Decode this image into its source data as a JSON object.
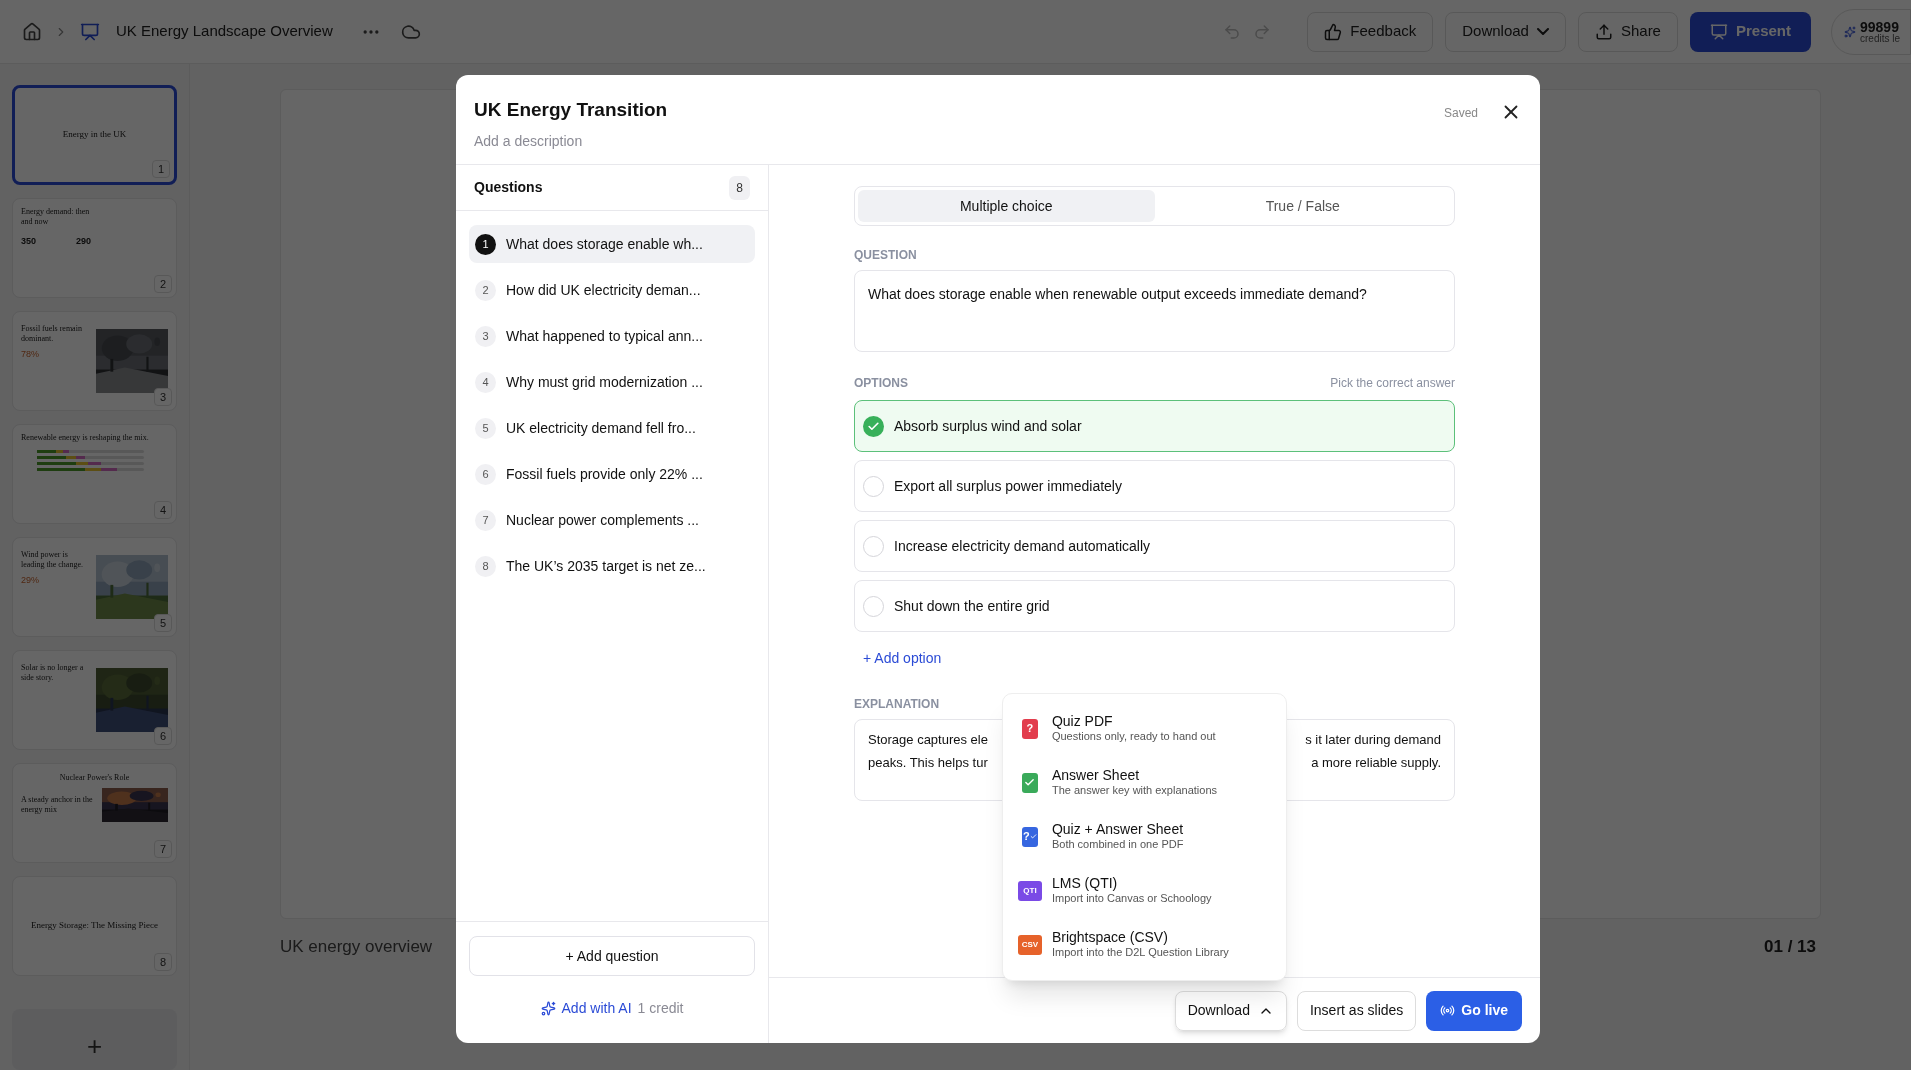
{
  "app": {
    "title": "UK Energy Landscape Overview",
    "feedback": "Feedback",
    "download": "Download",
    "share": "Share",
    "present": "Present",
    "credits": "99899",
    "credits_label": "credits le"
  },
  "slides": [
    {
      "number": "1",
      "kind": "title",
      "title": "Energy in the UK",
      "selected": true
    },
    {
      "number": "2",
      "kind": "stats",
      "title": "Energy demand: then and now",
      "stats": [
        "350",
        "290"
      ],
      "selected": false
    },
    {
      "number": "3",
      "title": "Fossil fuels remain dominant.",
      "figure": "78%",
      "selected": false
    },
    {
      "number": "4",
      "kind": "bars",
      "title": "Renewable energy is reshaping the mix.",
      "selected": false
    },
    {
      "number": "5",
      "title": "Wind power is leading the change.",
      "figure": "29%",
      "selected": false
    },
    {
      "number": "6",
      "title": "Solar is no longer a side story.",
      "selected": false
    },
    {
      "number": "7",
      "kind": "title-photo",
      "title": "Nuclear Power's Role",
      "subtitle": "A steady anchor in the energy mix",
      "selected": false
    },
    {
      "number": "8",
      "kind": "title",
      "title": "Energy Storage: The Missing Piece",
      "selected": false
    }
  ],
  "add_slide": "+",
  "stage": {
    "caption": "UK energy overview",
    "counter": "01 / 13"
  },
  "modal": {
    "title": "UK Energy Transition",
    "description_placeholder": "Add a description",
    "status": "Saved",
    "questions_header": "Questions",
    "question_count": "8",
    "questions": [
      {
        "number": "1",
        "text": "What does storage enable wh...",
        "selected": true
      },
      {
        "number": "2",
        "text": "How did UK electricity deman...",
        "selected": false
      },
      {
        "number": "3",
        "text": "What happened to typical ann...",
        "selected": false
      },
      {
        "number": "4",
        "text": "Why must grid modernization ...",
        "selected": false
      },
      {
        "number": "5",
        "text": "UK electricity demand fell fro...",
        "selected": false
      },
      {
        "number": "6",
        "text": "Fossil fuels provide only 22% ...",
        "selected": false
      },
      {
        "number": "7",
        "text": "Nuclear power complements ...",
        "selected": false
      },
      {
        "number": "8",
        "text": "The UK’s 2035 target is net ze...",
        "selected": false
      }
    ],
    "add_question": "+ Add question",
    "add_ai": "Add with AI",
    "ai_cost": "1 credit",
    "type_tabs": [
      {
        "label": "Multiple choice",
        "selected": true
      },
      {
        "label": "True / False",
        "selected": false
      }
    ],
    "question_label": "QUESTION",
    "question_text": "What does storage enable when renewable output exceeds immediate demand?",
    "options_label": "OPTIONS",
    "options_hint": "Pick the correct answer",
    "options": [
      {
        "text": "Absorb surplus wind and solar",
        "checked": true
      },
      {
        "text": "Export all surplus power immediately",
        "checked": false
      },
      {
        "text": "Increase electricity demand automatically",
        "checked": false
      },
      {
        "text": "Shut down the entire grid",
        "checked": false
      }
    ],
    "add_option": "+ Add option",
    "explanation_label": "EXPLANATION",
    "explanation_lines": [
      {
        "left": "Storage captures ele",
        "right": "s it later during demand"
      },
      {
        "left": "peaks. This helps tur",
        "right": "a more reliable supply."
      }
    ],
    "download": "Download",
    "download_expanded": true,
    "insert": "Insert as slides",
    "go_live": "Go live",
    "download_menu": [
      {
        "kind": "quiz",
        "glyph": "?",
        "title": "Quiz PDF",
        "subtitle": "Questions only, ready to hand out"
      },
      {
        "kind": "answers",
        "title": "Answer Sheet",
        "subtitle": "The answer key with explanations"
      },
      {
        "kind": "combined",
        "glyph": "?",
        "title": "Quiz + Answer Sheet",
        "subtitle": "Both combined in one PDF"
      },
      {
        "kind": "qti",
        "glyph": "QTI",
        "title": "LMS (QTI)",
        "subtitle": "Import into Canvas or Schoology"
      },
      {
        "kind": "csv",
        "glyph": "CSV",
        "title": "Brightspace (CSV)",
        "subtitle": "Import into the D2L Question Library"
      }
    ]
  }
}
